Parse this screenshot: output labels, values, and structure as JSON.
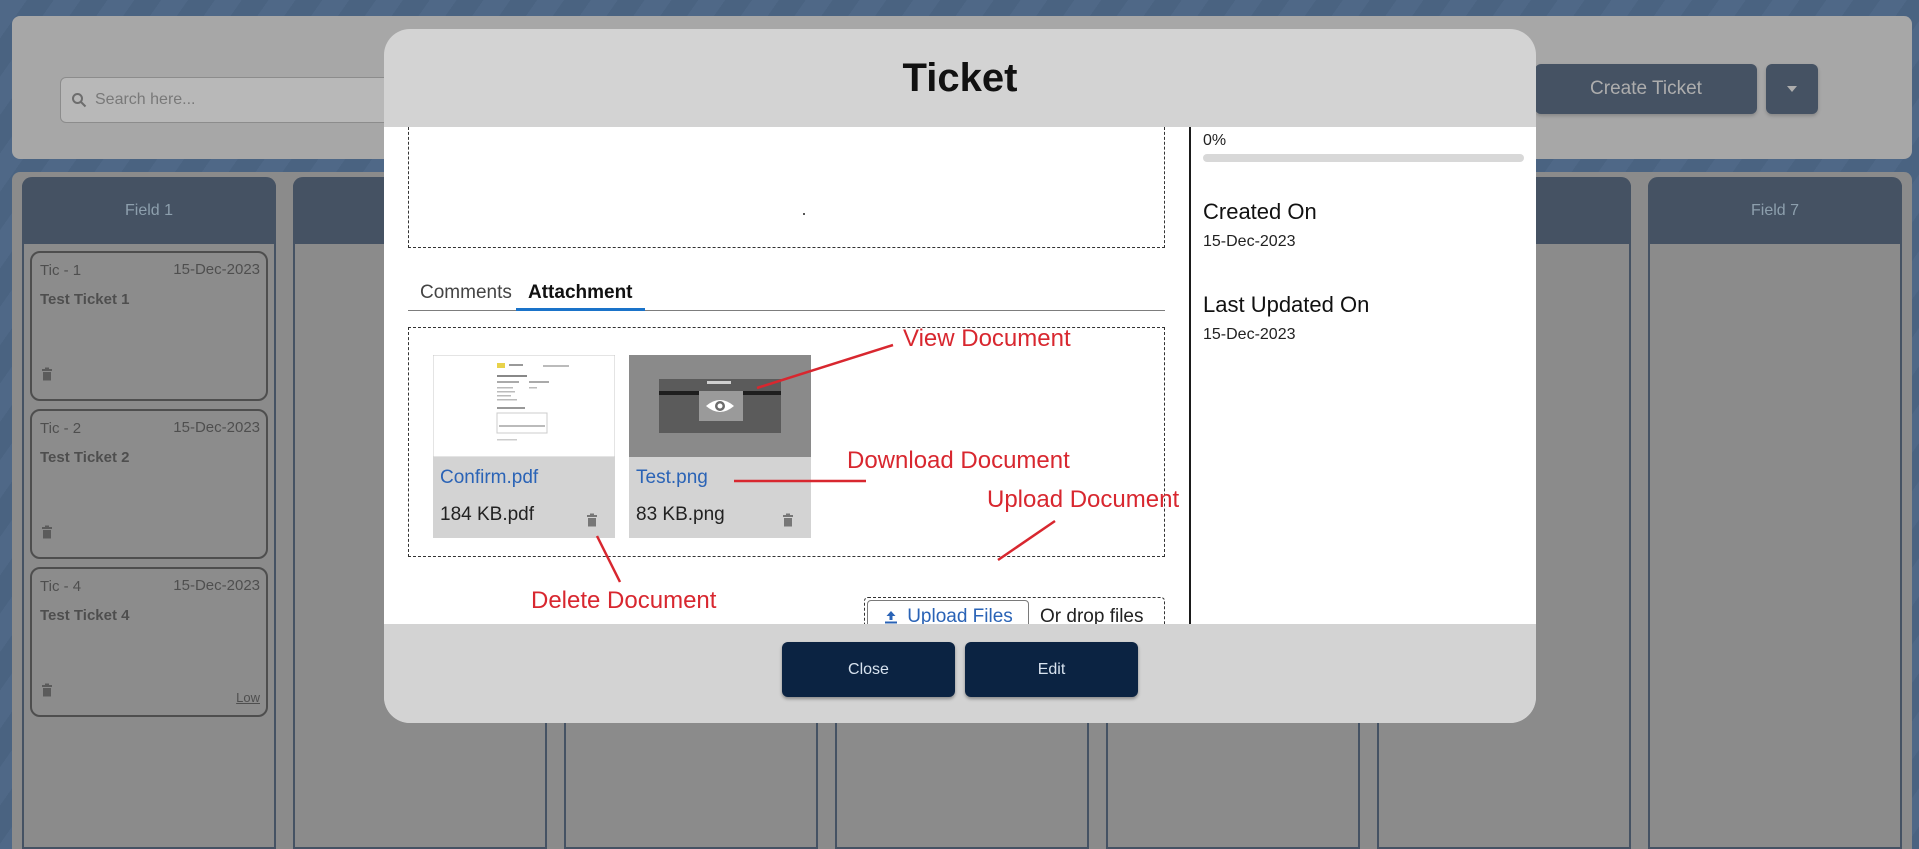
{
  "header": {
    "search_placeholder": "Search here...",
    "create_button": "Create Ticket",
    "dropdown_icon": "caret-down-icon"
  },
  "board": {
    "columns": [
      {
        "label": "Field 1"
      },
      {
        "label": ""
      },
      {
        "label": ""
      },
      {
        "label": ""
      },
      {
        "label": ""
      },
      {
        "label": ""
      },
      {
        "label": "Field 7"
      }
    ],
    "cards": [
      {
        "id": "Tic - 1",
        "date": "15-Dec-2023",
        "title": "Test Ticket 1",
        "priority": ""
      },
      {
        "id": "Tic - 2",
        "date": "15-Dec-2023",
        "title": "Test Ticket 2",
        "priority": ""
      },
      {
        "id": "Tic - 4",
        "date": "15-Dec-2023",
        "title": "Test Ticket 4",
        "priority": "Low"
      }
    ]
  },
  "modal": {
    "title": "Ticket",
    "tabs": [
      "Comments",
      "Attachment"
    ],
    "active_tab": "Attachment",
    "attachments": [
      {
        "name": "Confirm.pdf",
        "size": "184 KB.pdf"
      },
      {
        "name": "Test.png",
        "size": "83 KB.png"
      }
    ],
    "upload_button": "Upload Files",
    "drop_text": "Or drop files",
    "progress": {
      "label": "0%",
      "value": 0
    },
    "created_label": "Created On",
    "created_value": "15-Dec-2023",
    "updated_label": "Last Updated On",
    "updated_value": "15-Dec-2023",
    "close_button": "Close",
    "edit_button": "Edit"
  },
  "annotations": {
    "view": "View Document",
    "download": "Download Document",
    "upload": "Upload Document",
    "delete": "Delete Document"
  },
  "colors": {
    "navy": "#0b2342",
    "link_blue": "#2a63b6",
    "annotation_red": "#d8272f"
  }
}
